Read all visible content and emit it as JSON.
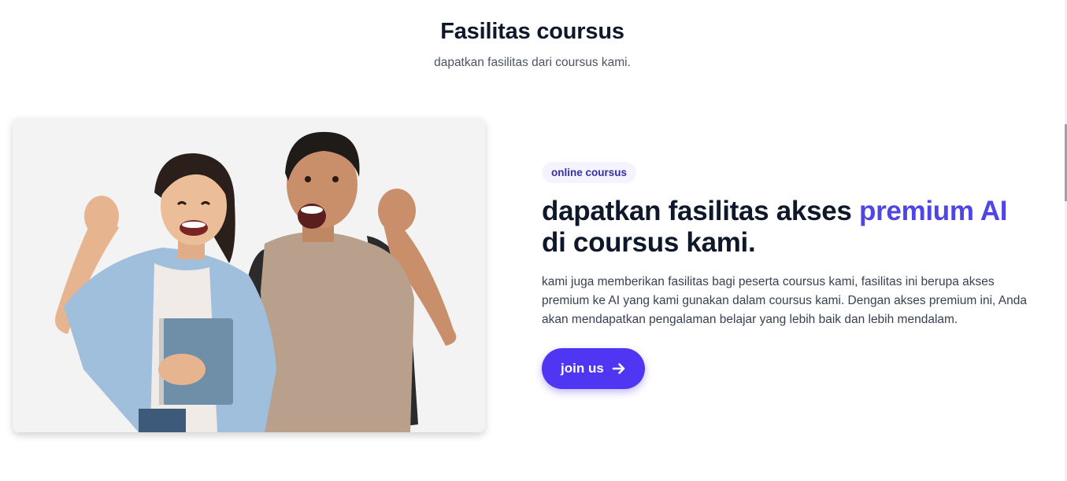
{
  "section": {
    "title": "Fasilitas coursus",
    "subtitle": "dapatkan fasilitas dari coursus kami."
  },
  "feature": {
    "badge": "online coursus",
    "headline_part1": "dapatkan fasilitas akses ",
    "headline_accent": "premium AI",
    "headline_part2": "di coursus kami.",
    "description": "kami juga memberikan fasilitas bagi peserta coursus kami, fasilitas ini berupa akses premium ke AI yang kami gunakan dalam coursus kami. Dengan akses premium ini, Anda akan mendapatkan pengalaman belajar yang lebih baik dan lebih mendalam.",
    "button_label": "join us",
    "button_icon": "arrow-right-icon"
  },
  "colors": {
    "accent": "#4f46e5",
    "button": "#4f36f2",
    "heading": "#0f172a",
    "badge_bg": "#f5f3ff",
    "badge_text": "#3730a3"
  }
}
